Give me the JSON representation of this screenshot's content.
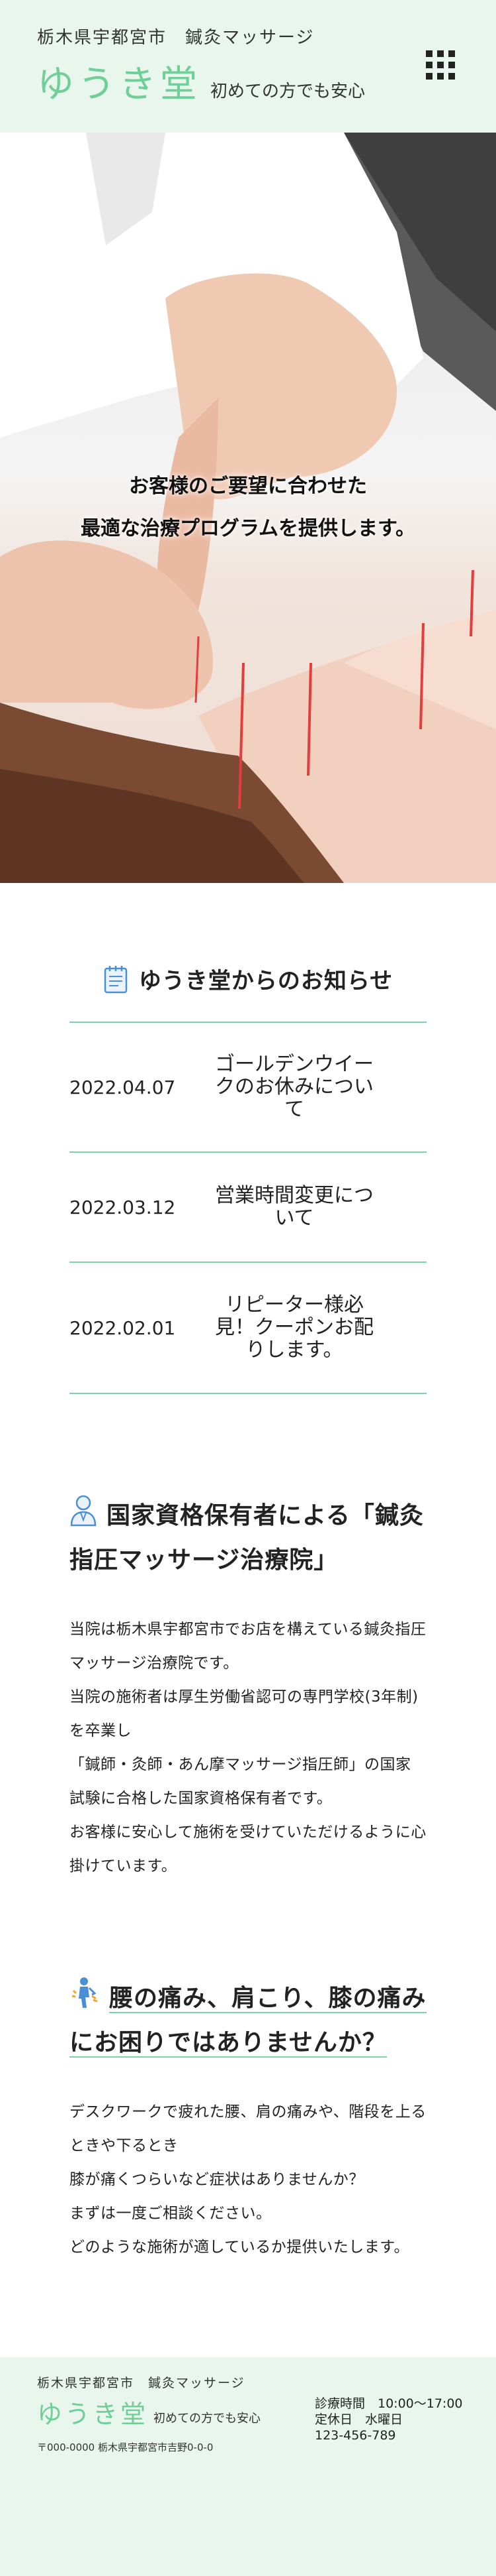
{
  "header": {
    "region": "栃木県宇都宮市　鍼灸マッサージ",
    "logo": "ゆうき堂",
    "tagline": "初めての方でも安心",
    "menu_icon": "grid-menu-icon"
  },
  "hero": {
    "line1": "お客様のご要望に合わせた",
    "line2": "最適な治療プログラムを提供します。"
  },
  "news": {
    "title": "ゆうき堂からのお知らせ",
    "icon": "notepad-icon",
    "items": [
      {
        "date": "2022.04.07",
        "text": "ゴールデンウイークのお休みについて"
      },
      {
        "date": "2022.03.12",
        "text": "営業時間変更について"
      },
      {
        "date": "2022.02.01",
        "text": "リピーター様必見！クーポンお配りします。"
      }
    ]
  },
  "qualification": {
    "icon": "doctor-icon",
    "title": "国家資格保有者による「鍼灸指圧マッサージ治療院」",
    "paragraphs": [
      "当院は栃木県宇都宮市でお店を構えている鍼灸指圧マッサージ治療院です。",
      "当院の施術者は厚生労働省認可の専門学校(3年制)を卒業し",
      "「鍼師・灸師・あん摩マッサージ指圧師」の国家試験に合格した国家資格保有者です。",
      "お客様に安心して施術を受けていただけるように心掛けています。"
    ]
  },
  "worries": {
    "icon": "back-pain-icon",
    "title": "腰の痛み、肩こり、膝の痛みにお困りではありませんか？",
    "paragraphs": [
      "デスクワークで疲れた腰、肩の痛みや、階段を上るときや下るとき",
      "膝が痛くつらいなど症状はありませんか？",
      "まずは一度ご相談ください。",
      "どのような施術が適しているか提供いたします。"
    ]
  },
  "footer": {
    "region": "栃木県宇都宮市　鍼灸マッサージ",
    "logo": "ゆうき堂",
    "tagline": "初めての方でも安心",
    "address": "〒000-0000 栃木県宇都宮市吉野0-0-0",
    "hours": "診療時間　10:00～17:00",
    "closed": "定休日　水曜日",
    "phone": "123-456-789"
  },
  "colors": {
    "accent": "#6fcf97",
    "rule": "#7dd3a4",
    "header_bg": "#e8f6ee"
  }
}
